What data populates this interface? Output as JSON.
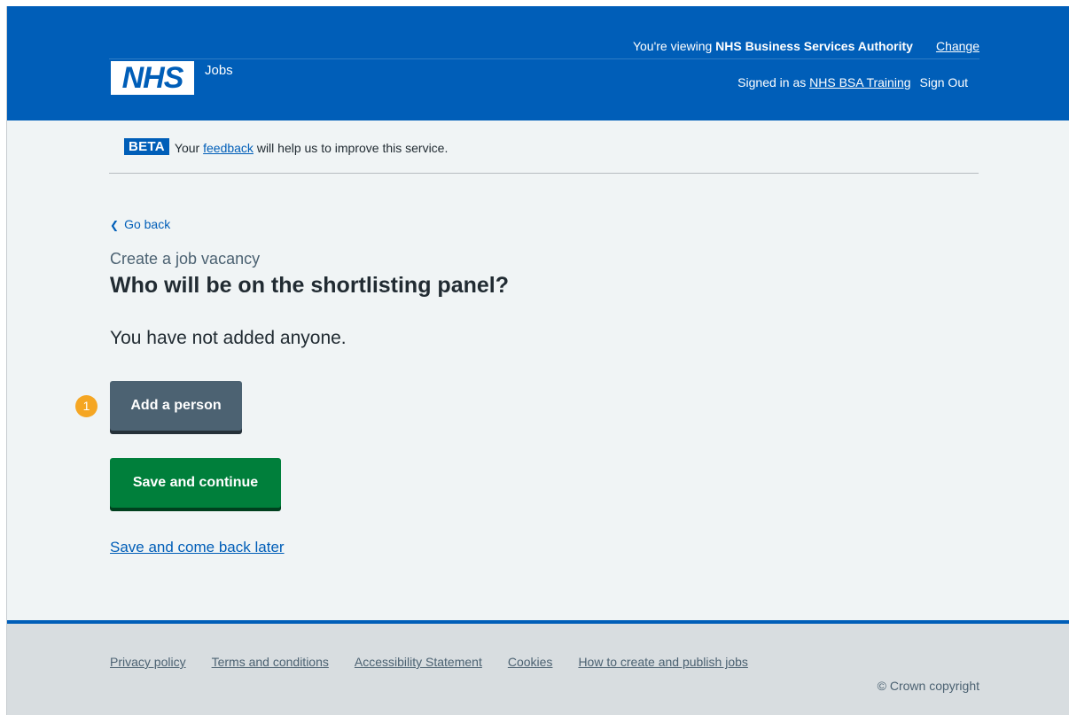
{
  "header": {
    "viewing_prefix": "You're viewing ",
    "organisation": "NHS Business Services Authority",
    "change_label": "Change",
    "signed_in_prefix": "Signed in as ",
    "user_name": "NHS BSA Training",
    "sign_out_label": "Sign Out",
    "logo_text": "NHS",
    "service_name": "Jobs"
  },
  "beta": {
    "tag": "BETA",
    "text_before": "Your ",
    "link": "feedback",
    "text_after": " will help us to improve this service."
  },
  "nav": {
    "back_label": "Go back",
    "back_icon": "chevron-left-icon"
  },
  "main": {
    "caption": "Create a job vacancy",
    "title": "Who will be on the shortlisting panel?",
    "empty_text": "You have not added anyone.",
    "add_person_label": "Add a person",
    "save_continue_label": "Save and continue",
    "save_later_label": "Save and come back later"
  },
  "marker": {
    "number": "1",
    "color": "#f5a623"
  },
  "footer": {
    "links": [
      "Privacy policy",
      "Terms and conditions",
      "Accessibility Statement",
      "Cookies",
      "How to create and publish jobs"
    ],
    "copyright": "© Crown copyright"
  },
  "colors": {
    "header_blue": "#005eb8",
    "primary_green": "#007f3b",
    "secondary_grey": "#4c6272",
    "page_bg": "#f0f4f5",
    "footer_bg": "#d8dde0"
  }
}
